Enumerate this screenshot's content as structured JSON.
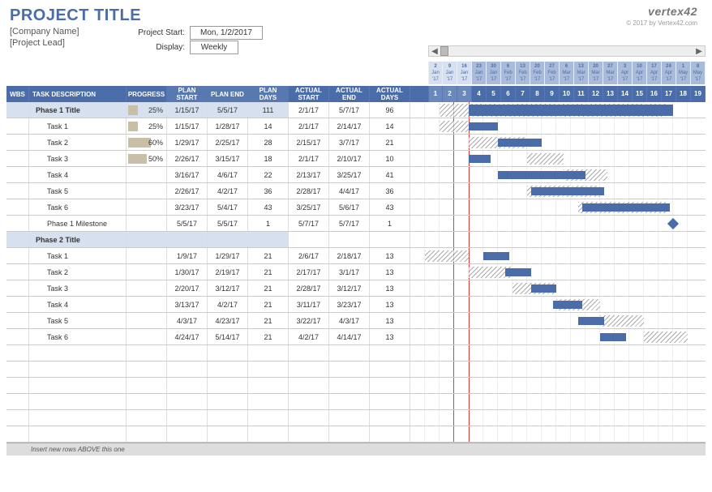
{
  "header": {
    "title": "PROJECT TITLE",
    "company": "[Company Name]",
    "lead": "[Project Lead]",
    "start_label": "Project Start:",
    "start_value": "Mon, 1/2/2017",
    "display_label": "Display:",
    "display_value": "Weekly",
    "logo_text": "vertex42",
    "copyright": "© 2017 by Vertex42.com"
  },
  "columns": {
    "wbs": "WBS",
    "desc": "TASK DESCRIPTION",
    "prog": "PROGRESS",
    "plan_start": "PLAN START",
    "plan_end": "PLAN END",
    "plan_days": "PLAN DAYS",
    "actual_start": "ACTUAL START",
    "actual_end": "ACTUAL END",
    "actual_days": "ACTUAL DAYS"
  },
  "timeline": {
    "dates": [
      {
        "d": "2",
        "m": "Jan",
        "y": "'17"
      },
      {
        "d": "9",
        "m": "Jan",
        "y": "'17"
      },
      {
        "d": "16",
        "m": "Jan",
        "y": "'17"
      },
      {
        "d": "23",
        "m": "Jan",
        "y": "'17"
      },
      {
        "d": "30",
        "m": "Jan",
        "y": "'17"
      },
      {
        "d": "6",
        "m": "Feb",
        "y": "'17"
      },
      {
        "d": "13",
        "m": "Feb",
        "y": "'17"
      },
      {
        "d": "20",
        "m": "Feb",
        "y": "'17"
      },
      {
        "d": "27",
        "m": "Feb",
        "y": "'17"
      },
      {
        "d": "6",
        "m": "Mar",
        "y": "'17"
      },
      {
        "d": "13",
        "m": "Mar",
        "y": "'17"
      },
      {
        "d": "20",
        "m": "Mar",
        "y": "'17"
      },
      {
        "d": "27",
        "m": "Mar",
        "y": "'17"
      },
      {
        "d": "3",
        "m": "Apr",
        "y": "'17"
      },
      {
        "d": "10",
        "m": "Apr",
        "y": "'17"
      },
      {
        "d": "17",
        "m": "Apr",
        "y": "'17"
      },
      {
        "d": "24",
        "m": "Apr",
        "y": "'17"
      },
      {
        "d": "1",
        "m": "May",
        "y": "'17"
      },
      {
        "d": "8",
        "m": "May",
        "y": "'17"
      }
    ],
    "weeks": [
      "1",
      "2",
      "3",
      "4",
      "5",
      "6",
      "7",
      "8",
      "9",
      "10",
      "11",
      "12",
      "13",
      "14",
      "15",
      "16",
      "17",
      "18",
      "19"
    ],
    "dark": [
      3,
      4,
      5,
      6,
      7,
      8,
      9,
      10,
      11,
      12,
      13,
      14,
      15,
      16,
      17,
      18
    ]
  },
  "tasks": [
    {
      "type": "phase",
      "desc": "Phase 1 Title",
      "progress": "25%",
      "pbar": 25,
      "plan_start": "1/15/17",
      "plan_end": "5/5/17",
      "plan_days": "111",
      "actual_start": "2/1/17",
      "actual_end": "5/7/17",
      "actual_days": "96",
      "g_plan": [
        2,
        17.5
      ],
      "g_actual": [
        4,
        18
      ]
    },
    {
      "type": "task",
      "desc": "Task 1",
      "progress": "25%",
      "pbar": 25,
      "plan_start": "1/15/17",
      "plan_end": "1/28/17",
      "plan_days": "14",
      "actual_start": "2/1/17",
      "actual_end": "2/14/17",
      "actual_days": "14",
      "g_plan": [
        2,
        4
      ],
      "g_actual": [
        4,
        6
      ]
    },
    {
      "type": "task",
      "desc": "Task 2",
      "progress": "60%",
      "pbar": 60,
      "plan_start": "1/29/17",
      "plan_end": "2/25/17",
      "plan_days": "28",
      "actual_start": "2/15/17",
      "actual_end": "3/7/17",
      "actual_days": "21",
      "g_plan": [
        4,
        8
      ],
      "g_actual": [
        6,
        9
      ]
    },
    {
      "type": "task",
      "desc": "Task 3",
      "progress": "50%",
      "pbar": 50,
      "plan_start": "2/26/17",
      "plan_end": "3/15/17",
      "plan_days": "18",
      "actual_start": "2/1/17",
      "actual_end": "2/10/17",
      "actual_days": "10",
      "g_plan": [
        8,
        10.5
      ],
      "g_actual": [
        4,
        5.5
      ]
    },
    {
      "type": "task",
      "desc": "Task 4",
      "progress": "",
      "plan_start": "3/16/17",
      "plan_end": "4/6/17",
      "plan_days": "22",
      "actual_start": "2/13/17",
      "actual_end": "3/25/17",
      "actual_days": "41",
      "g_plan": [
        10.5,
        13.5
      ],
      "g_actual": [
        6,
        12
      ]
    },
    {
      "type": "task",
      "desc": "Task 5",
      "progress": "",
      "plan_start": "2/26/17",
      "plan_end": "4/2/17",
      "plan_days": "36",
      "actual_start": "2/28/17",
      "actual_end": "4/4/17",
      "actual_days": "36",
      "g_plan": [
        8,
        13
      ],
      "g_actual": [
        8.3,
        13.3
      ]
    },
    {
      "type": "task",
      "desc": "Task 6",
      "progress": "",
      "plan_start": "3/23/17",
      "plan_end": "5/4/17",
      "plan_days": "43",
      "actual_start": "3/25/17",
      "actual_end": "5/6/17",
      "actual_days": "43",
      "g_plan": [
        11.5,
        17.5
      ],
      "g_actual": [
        11.8,
        17.8
      ]
    },
    {
      "type": "task",
      "desc": "Phase 1 Milestone",
      "progress": "",
      "plan_start": "5/5/17",
      "plan_end": "5/5/17",
      "plan_days": "1",
      "actual_start": "5/7/17",
      "actual_end": "5/7/17",
      "actual_days": "1",
      "milestone": 18
    },
    {
      "type": "phase",
      "desc": "Phase 2 Title",
      "progress": "",
      "plan_start": "",
      "plan_end": "",
      "plan_days": "",
      "actual_start": "",
      "actual_end": "",
      "actual_days": ""
    },
    {
      "type": "task",
      "desc": "Task 1",
      "progress": "",
      "plan_start": "1/9/17",
      "plan_end": "1/29/17",
      "plan_days": "21",
      "actual_start": "2/6/17",
      "actual_end": "2/18/17",
      "actual_days": "13",
      "g_plan": [
        1,
        4
      ],
      "g_actual": [
        5,
        6.8
      ]
    },
    {
      "type": "task",
      "desc": "Task 2",
      "progress": "",
      "plan_start": "1/30/17",
      "plan_end": "2/19/17",
      "plan_days": "21",
      "actual_start": "2/17/17",
      "actual_end": "3/1/17",
      "actual_days": "13",
      "g_plan": [
        4,
        7
      ],
      "g_actual": [
        6.5,
        8.3
      ]
    },
    {
      "type": "task",
      "desc": "Task 3",
      "progress": "",
      "plan_start": "2/20/17",
      "plan_end": "3/12/17",
      "plan_days": "21",
      "actual_start": "2/28/17",
      "actual_end": "3/12/17",
      "actual_days": "13",
      "g_plan": [
        7,
        10
      ],
      "g_actual": [
        8.3,
        10
      ]
    },
    {
      "type": "task",
      "desc": "Task 4",
      "progress": "",
      "plan_start": "3/13/17",
      "plan_end": "4/2/17",
      "plan_days": "21",
      "actual_start": "3/11/17",
      "actual_end": "3/23/17",
      "actual_days": "13",
      "g_plan": [
        10,
        13
      ],
      "g_actual": [
        9.8,
        11.8
      ]
    },
    {
      "type": "task",
      "desc": "Task 5",
      "progress": "",
      "plan_start": "4/3/17",
      "plan_end": "4/23/17",
      "plan_days": "21",
      "actual_start": "3/22/17",
      "actual_end": "4/3/17",
      "actual_days": "13",
      "g_plan": [
        13,
        16
      ],
      "g_actual": [
        11.5,
        13.3
      ]
    },
    {
      "type": "task",
      "desc": "Task 6",
      "progress": "",
      "plan_start": "4/24/17",
      "plan_end": "5/14/17",
      "plan_days": "21",
      "actual_start": "4/2/17",
      "actual_end": "4/14/17",
      "actual_days": "13",
      "g_plan": [
        16,
        19
      ],
      "g_actual": [
        13,
        14.8
      ]
    }
  ],
  "footer": {
    "note": "Insert new rows ABOVE this one"
  },
  "chart_data": {
    "type": "gantt",
    "title": "PROJECT TITLE",
    "x_start": "2017-01-02",
    "x_unit": "week",
    "weeks": 19,
    "today_marker_week": 3.5,
    "series": [
      {
        "name": "Phase 1 Title",
        "plan": [
          "2017-01-15",
          "2017-05-05"
        ],
        "actual": [
          "2017-02-01",
          "2017-05-07"
        ],
        "progress": 25
      },
      {
        "name": "Task 1 (P1)",
        "plan": [
          "2017-01-15",
          "2017-01-28"
        ],
        "actual": [
          "2017-02-01",
          "2017-02-14"
        ],
        "progress": 25
      },
      {
        "name": "Task 2 (P1)",
        "plan": [
          "2017-01-29",
          "2017-02-25"
        ],
        "actual": [
          "2017-02-15",
          "2017-03-07"
        ],
        "progress": 60
      },
      {
        "name": "Task 3 (P1)",
        "plan": [
          "2017-02-26",
          "2017-03-15"
        ],
        "actual": [
          "2017-02-01",
          "2017-02-10"
        ],
        "progress": 50
      },
      {
        "name": "Task 4 (P1)",
        "plan": [
          "2017-03-16",
          "2017-04-06"
        ],
        "actual": [
          "2017-02-13",
          "2017-03-25"
        ]
      },
      {
        "name": "Task 5 (P1)",
        "plan": [
          "2017-02-26",
          "2017-04-02"
        ],
        "actual": [
          "2017-02-28",
          "2017-04-04"
        ]
      },
      {
        "name": "Task 6 (P1)",
        "plan": [
          "2017-03-23",
          "2017-05-04"
        ],
        "actual": [
          "2017-03-25",
          "2017-05-06"
        ]
      },
      {
        "name": "Phase 1 Milestone",
        "plan": [
          "2017-05-05",
          "2017-05-05"
        ],
        "actual": [
          "2017-05-07",
          "2017-05-07"
        ],
        "milestone": true
      },
      {
        "name": "Task 1 (P2)",
        "plan": [
          "2017-01-09",
          "2017-01-29"
        ],
        "actual": [
          "2017-02-06",
          "2017-02-18"
        ]
      },
      {
        "name": "Task 2 (P2)",
        "plan": [
          "2017-01-30",
          "2017-02-19"
        ],
        "actual": [
          "2017-02-17",
          "2017-03-01"
        ]
      },
      {
        "name": "Task 3 (P2)",
        "plan": [
          "2017-02-20",
          "2017-03-12"
        ],
        "actual": [
          "2017-02-28",
          "2017-03-12"
        ]
      },
      {
        "name": "Task 4 (P2)",
        "plan": [
          "2017-03-13",
          "2017-04-02"
        ],
        "actual": [
          "2017-03-11",
          "2017-03-23"
        ]
      },
      {
        "name": "Task 5 (P2)",
        "plan": [
          "2017-04-03",
          "2017-04-23"
        ],
        "actual": [
          "2017-03-22",
          "2017-04-03"
        ]
      },
      {
        "name": "Task 6 (P2)",
        "plan": [
          "2017-04-24",
          "2017-05-14"
        ],
        "actual": [
          "2017-04-02",
          "2017-04-14"
        ]
      }
    ]
  }
}
